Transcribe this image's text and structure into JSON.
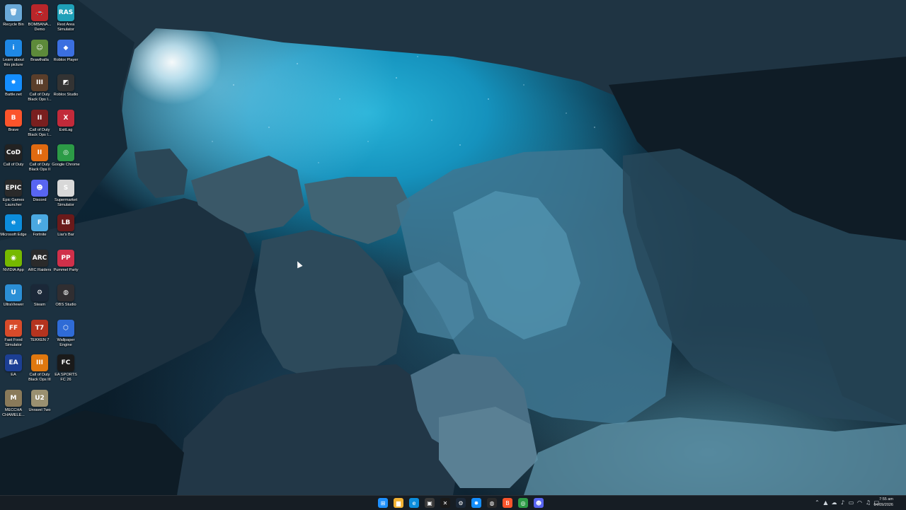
{
  "desktop_icons": [
    {
      "label": "Recycle Bin",
      "icon": "recycle-bin-icon",
      "glyph": "🗑",
      "color": "#6aa9d8"
    },
    {
      "label": "Learn about this picture",
      "icon": "learn-picture-icon",
      "glyph": "i",
      "color": "#1e88e5"
    },
    {
      "label": "Battle.net",
      "icon": "battlenet-icon",
      "glyph": "✸",
      "color": "#148eff"
    },
    {
      "label": "Brave",
      "icon": "brave-icon",
      "glyph": "B",
      "color": "#fb542b"
    },
    {
      "label": "Call of Duty",
      "icon": "call-of-duty-icon",
      "glyph": "CoD",
      "color": "#222222"
    },
    {
      "label": "Epic Games Launcher",
      "icon": "epic-games-icon",
      "glyph": "EPIC",
      "color": "#2a2a2a"
    },
    {
      "label": "Microsoft Edge",
      "icon": "edge-icon",
      "glyph": "e",
      "color": "#0c8ddc"
    },
    {
      "label": "NVIDIA App",
      "icon": "nvidia-icon",
      "glyph": "◉",
      "color": "#76b900"
    },
    {
      "label": "UltraViewer",
      "icon": "ultraviewer-icon",
      "glyph": "U",
      "color": "#2b8fd6"
    },
    {
      "label": "Fast Food Simulator",
      "icon": "fast-food-simulator-icon",
      "glyph": "FF",
      "color": "#d84b2a"
    },
    {
      "label": "EA",
      "icon": "ea-icon",
      "glyph": "EA",
      "color": "#1c3f94"
    },
    {
      "label": "MECCHA CHAMELE...",
      "icon": "meccha-chameleon-icon",
      "glyph": "M",
      "color": "#8a7a5a"
    },
    {
      "label": "BOMBANA... Demo",
      "icon": "bombana-demo-icon",
      "glyph": "🚗",
      "color": "#b8262a"
    },
    {
      "label": "Brawlhalla",
      "icon": "brawlhalla-icon",
      "glyph": "☺",
      "color": "#5d8a3a"
    },
    {
      "label": "Call of Duty Black Ops I...",
      "icon": "cod-black-ops-icon",
      "glyph": "III",
      "color": "#5a3e2a"
    },
    {
      "label": "Call of Duty Black Ops I...",
      "icon": "cod-black-ops-2-icon",
      "glyph": "II",
      "color": "#7a1f1f"
    },
    {
      "label": "Call of Duty Black Ops II",
      "icon": "cod-black-ops-ii-icon",
      "glyph": "II",
      "color": "#e06a10"
    },
    {
      "label": "Discord",
      "icon": "discord-icon",
      "glyph": "☻",
      "color": "#5865f2"
    },
    {
      "label": "Fortnite",
      "icon": "fortnite-icon",
      "glyph": "F",
      "color": "#4aa8e0"
    },
    {
      "label": "ARC Raiders",
      "icon": "arc-raiders-icon",
      "glyph": "ARC",
      "color": "#2a2a2a"
    },
    {
      "label": "Steam",
      "icon": "steam-icon",
      "glyph": "⚙",
      "color": "#1b2838"
    },
    {
      "label": "TEKKEN 7",
      "icon": "tekken-icon",
      "glyph": "T7",
      "color": "#b5341f"
    },
    {
      "label": "Call of Duty Black Ops III",
      "icon": "cod-black-ops-iii-icon",
      "glyph": "III",
      "color": "#e0780f"
    },
    {
      "label": "Unravel Two",
      "icon": "unravel-two-icon",
      "glyph": "U2",
      "color": "#9a9070"
    },
    {
      "label": "Rest Area Simulator",
      "icon": "rest-area-simulator-icon",
      "glyph": "RAS",
      "color": "#1fa0b8"
    },
    {
      "label": "Roblox Player",
      "icon": "roblox-player-icon",
      "glyph": "◆",
      "color": "#3b6fe0"
    },
    {
      "label": "Roblox Studio",
      "icon": "roblox-studio-icon",
      "glyph": "◩",
      "color": "#333333"
    },
    {
      "label": "ExitLag",
      "icon": "exitlag-icon",
      "glyph": "X",
      "color": "#c22a3a"
    },
    {
      "label": "Google Chrome",
      "icon": "chrome-icon",
      "glyph": "◎",
      "color": "#2c9b46"
    },
    {
      "label": "Supermarket Simulator",
      "icon": "supermarket-simulator-icon",
      "glyph": "S",
      "color": "#d8d8d8"
    },
    {
      "label": "Liar's Bar",
      "icon": "liars-bar-icon",
      "glyph": "LB",
      "color": "#6a1a1a"
    },
    {
      "label": "Pummel Party",
      "icon": "pummel-party-icon",
      "glyph": "PP",
      "color": "#d0304a"
    },
    {
      "label": "OBS Studio",
      "icon": "obs-studio-icon",
      "glyph": "◍",
      "color": "#302e31"
    },
    {
      "label": "Wallpaper Engine",
      "icon": "wallpaper-engine-icon",
      "glyph": "⬡",
      "color": "#2f6bd6"
    },
    {
      "label": "EA SPORTS FC 26",
      "icon": "ea-sports-fc-icon",
      "glyph": "FC",
      "color": "#1a1a1a"
    }
  ],
  "taskbar": {
    "apps": [
      {
        "icon": "windows-start-icon",
        "glyph": "⊞",
        "color": "#1e90ff"
      },
      {
        "icon": "file-explorer-icon",
        "glyph": "▆",
        "color": "#f2b233"
      },
      {
        "icon": "edge-taskbar-icon",
        "glyph": "e",
        "color": "#0c8ddc"
      },
      {
        "icon": "store-icon",
        "glyph": "▣",
        "color": "#3a3a3a"
      },
      {
        "icon": "capcut-icon",
        "glyph": "✕",
        "color": "#1a1a1a"
      },
      {
        "icon": "steam-taskbar-icon",
        "glyph": "⚙",
        "color": "#1b2838"
      },
      {
        "icon": "battlenet-taskbar-icon",
        "glyph": "✸",
        "color": "#148eff"
      },
      {
        "icon": "github-icon",
        "glyph": "◍",
        "color": "#2a2a2a"
      },
      {
        "icon": "brave-taskbar-icon",
        "glyph": "B",
        "color": "#fb542b"
      },
      {
        "icon": "chrome-taskbar-icon",
        "glyph": "◎",
        "color": "#2c9b46"
      },
      {
        "icon": "discord-taskbar-icon",
        "glyph": "☻",
        "color": "#5865f2"
      }
    ],
    "tray": [
      {
        "icon": "chevron-up-icon",
        "glyph": "⌃"
      },
      {
        "icon": "network-icon",
        "glyph": "▲"
      },
      {
        "icon": "cloud-icon",
        "glyph": "☁"
      },
      {
        "icon": "microphone-icon",
        "glyph": "♪"
      },
      {
        "icon": "battery-icon",
        "glyph": "▭"
      },
      {
        "icon": "wifi-icon",
        "glyph": "◠"
      },
      {
        "icon": "volume-icon",
        "glyph": "♫"
      },
      {
        "icon": "notification-icon",
        "glyph": "▢"
      }
    ],
    "time": "7:55 am",
    "date": "04/09/2026"
  }
}
